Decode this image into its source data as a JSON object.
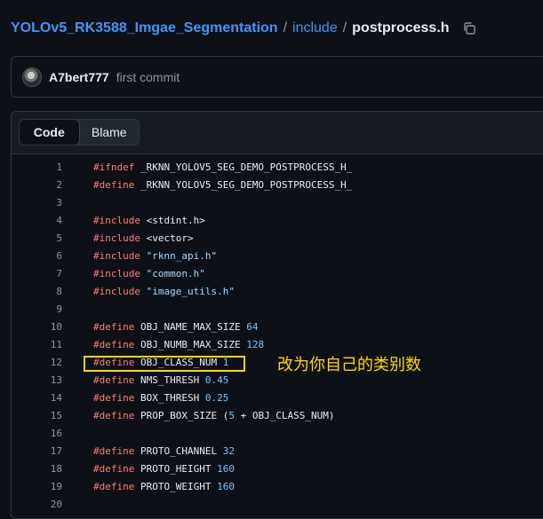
{
  "breadcrumb": {
    "repo": "YOLOv5_RK3588_Imgae_Segmentation",
    "sep1": "/",
    "folder": "include",
    "sep2": "/",
    "file": "postprocess.h"
  },
  "commit": {
    "author": "A7bert777",
    "message": "first commit"
  },
  "view_tabs": [
    "Code",
    "Blame"
  ],
  "code_lines": [
    {
      "n": "1",
      "parts": [
        [
          "kw",
          "#ifndef"
        ],
        [
          "txt",
          " _RKNN_YOLOV5_SEG_DEMO_POSTPROCESS_H_"
        ]
      ]
    },
    {
      "n": "2",
      "parts": [
        [
          "kw",
          "#define"
        ],
        [
          "txt",
          " _RKNN_YOLOV5_SEG_DEMO_POSTPROCESS_H_"
        ]
      ]
    },
    {
      "n": "3",
      "parts": []
    },
    {
      "n": "4",
      "parts": [
        [
          "kw",
          "#include"
        ],
        [
          "txt",
          " <stdint.h>"
        ]
      ]
    },
    {
      "n": "5",
      "parts": [
        [
          "kw",
          "#include"
        ],
        [
          "txt",
          " <vector>"
        ]
      ]
    },
    {
      "n": "6",
      "parts": [
        [
          "kw",
          "#include"
        ],
        [
          "txt",
          " "
        ],
        [
          "str",
          "\"rknn_api.h\""
        ]
      ]
    },
    {
      "n": "7",
      "parts": [
        [
          "kw",
          "#include"
        ],
        [
          "txt",
          " "
        ],
        [
          "str",
          "\"common.h\""
        ]
      ]
    },
    {
      "n": "8",
      "parts": [
        [
          "kw",
          "#include"
        ],
        [
          "txt",
          " "
        ],
        [
          "str",
          "\"image_utils.h\""
        ]
      ]
    },
    {
      "n": "9",
      "parts": []
    },
    {
      "n": "10",
      "parts": [
        [
          "kw",
          "#define"
        ],
        [
          "txt",
          " OBJ_NAME_MAX_SIZE "
        ],
        [
          "num",
          "64"
        ]
      ]
    },
    {
      "n": "11",
      "parts": [
        [
          "kw",
          "#define"
        ],
        [
          "txt",
          " OBJ_NUMB_MAX_SIZE "
        ],
        [
          "num",
          "128"
        ]
      ]
    },
    {
      "n": "12",
      "parts": [
        [
          "kw",
          "#define"
        ],
        [
          "txt",
          " OBJ_CLASS_NUM "
        ],
        [
          "num",
          "1"
        ]
      ]
    },
    {
      "n": "13",
      "parts": [
        [
          "kw",
          "#define"
        ],
        [
          "txt",
          " NMS_THRESH "
        ],
        [
          "num",
          "0.45"
        ]
      ]
    },
    {
      "n": "14",
      "parts": [
        [
          "kw",
          "#define"
        ],
        [
          "txt",
          " BOX_THRESH "
        ],
        [
          "num",
          "0.25"
        ]
      ]
    },
    {
      "n": "15",
      "parts": [
        [
          "kw",
          "#define"
        ],
        [
          "txt",
          " PROP_BOX_SIZE ("
        ],
        [
          "num",
          "5"
        ],
        [
          "txt",
          " + OBJ_CLASS_NUM)"
        ]
      ]
    },
    {
      "n": "16",
      "parts": []
    },
    {
      "n": "17",
      "parts": [
        [
          "kw",
          "#define"
        ],
        [
          "txt",
          " PROTO_CHANNEL "
        ],
        [
          "num",
          "32"
        ]
      ]
    },
    {
      "n": "18",
      "parts": [
        [
          "kw",
          "#define"
        ],
        [
          "txt",
          " PROTO_HEIGHT "
        ],
        [
          "num",
          "160"
        ]
      ]
    },
    {
      "n": "19",
      "parts": [
        [
          "kw",
          "#define"
        ],
        [
          "txt",
          " PROTO_WEIGHT "
        ],
        [
          "num",
          "160"
        ]
      ]
    },
    {
      "n": "20",
      "parts": []
    }
  ],
  "annotation": {
    "note": "改为你自己的类别数",
    "color": "#ffd800"
  },
  "icons": {
    "copy": "copy-icon"
  }
}
